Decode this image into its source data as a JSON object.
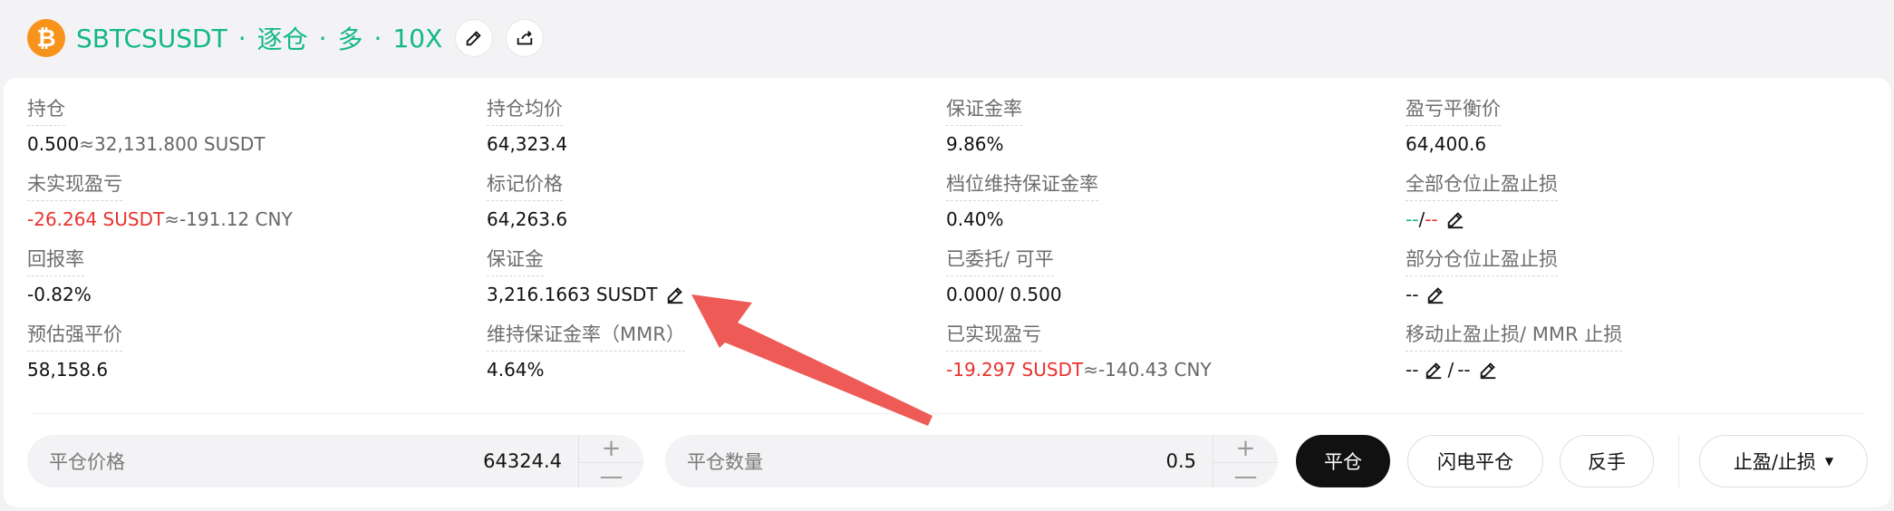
{
  "header": {
    "coin_glyph": "₿",
    "symbol": "SBTCSUSDT",
    "sep": "·",
    "margin_mode": "逐仓",
    "side": "多",
    "leverage": "10X"
  },
  "stats": {
    "position": {
      "label": "持仓",
      "qty": "0.500",
      "approx": "≈32,131.800 SUSDT"
    },
    "avg_price": {
      "label": "持仓均价",
      "value": "64,323.4"
    },
    "margin_ratio": {
      "label": "保证金率",
      "value": "9.86%"
    },
    "breakeven": {
      "label": "盈亏平衡价",
      "value": "64,400.6"
    },
    "unrealized_pnl": {
      "label": "未实现盈亏",
      "value": "-26.264 SUSDT",
      "approx": "≈-191.12 CNY"
    },
    "mark_price": {
      "label": "标记价格",
      "value": "64,263.6"
    },
    "tier_mmr": {
      "label": "档位维持保证金率",
      "value": "0.40%"
    },
    "full_tpsl": {
      "label": "全部仓位止盈止损",
      "tp": "--",
      "slash": "/",
      "sl": "--"
    },
    "roe": {
      "label": "回报率",
      "value": "-0.82%"
    },
    "margin": {
      "label": "保证金",
      "value": "3,216.1663 SUSDT"
    },
    "entrusted": {
      "label": "已委托/ 可平",
      "value": "0.000/ 0.500"
    },
    "partial_tpsl": {
      "label": "部分仓位止盈止损",
      "value": "--"
    },
    "liq_price": {
      "label": "预估强平价",
      "value": "58,158.6"
    },
    "mmr": {
      "label": "维持保证金率（MMR）",
      "value": "4.64%"
    },
    "realized_pnl": {
      "label": "已实现盈亏",
      "value": "-19.297 SUSDT",
      "approx": "≈-140.43 CNY"
    },
    "trailing_tpsl": {
      "label": "移动止盈止损/ MMR 止损",
      "left": "--",
      "slash": "/",
      "right": "--"
    }
  },
  "controls": {
    "close_price": {
      "placeholder": "平仓价格",
      "value": "64324.4"
    },
    "close_qty": {
      "placeholder": "平仓数量",
      "value": "0.5"
    },
    "plus": "+",
    "minus": "—",
    "close_btn": "平仓",
    "flash_close_btn": "闪电平仓",
    "reverse_btn": "反手",
    "tpsl_btn": "止盈/止损",
    "tpsl_caret": "▼"
  },
  "colors": {
    "accent_green": "#12b886",
    "loss_red": "#e8322d",
    "liq_orange": "#f6882e",
    "arrow_red": "#ee5a55"
  }
}
